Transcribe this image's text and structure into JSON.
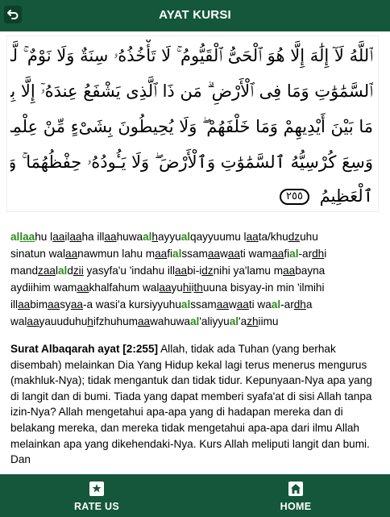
{
  "header": {
    "title": "AYAT KURSI",
    "back_icon": "back-arrow-icon"
  },
  "arabic": {
    "lines": [
      "ٱللَّهُ لَآ إِلَٰهَ إِلَّا هُوَ ٱلْحَىُّ ٱلْقَيُّومُ ۚ لَا تَأْخُذُهُۥ سِنَةٌ وَلَا نَوْمٌ ۚ لَّهُۥ مَا فِى",
      "ٱلسَّمَٰوَٰتِ وَمَا فِى ٱلْأَرْضِ ۗ مَن ذَا ٱلَّذِى يَشْفَعُ عِندَهُۥٓ إِلَّا بِإِذْنِهِۦ ۚ يَعْلَمُ",
      "مَا بَيْنَ أَيْدِيهِمْ وَمَا خَلْفَهُمْ ۖ وَلَا يُحِيطُونَ بِشَىْءٍ مِّنْ عِلْمِهِۦٓ إِلَّا بِمَا شَآءَ ۚ",
      "وَسِعَ كُرْسِيُّهُ ٱلسَّمَٰوَٰتِ وَٱلْأَرْضَ ۖ وَلَا يَـُٔودُهُۥ حِفْظُهُمَا ۚ وَهُوَ ٱلْعَلِىُّ",
      "ٱلْعَظِيمُ"
    ],
    "ayah_number": "٢٥٥"
  },
  "latin": {
    "l1": [
      {
        "t": "al",
        "s": "g"
      },
      {
        "t": "laa",
        "s": "gu"
      },
      {
        "t": "hu ",
        "s": ""
      },
      {
        "t": "l",
        "s": ""
      },
      {
        "t": "aa",
        "s": "u"
      },
      {
        "t": "il",
        "s": ""
      },
      {
        "t": "aa",
        "s": "u"
      },
      {
        "t": "ha ill",
        "s": ""
      },
      {
        "t": "aa",
        "s": "u"
      },
      {
        "t": "huwa",
        "s": ""
      },
      {
        "t": "al",
        "s": "g"
      },
      {
        "t": "h",
        "s": "u"
      },
      {
        "t": "ayyu",
        "s": ""
      },
      {
        "t": "al",
        "s": "g"
      },
      {
        "t": "qayyuumu l",
        "s": ""
      },
      {
        "t": "aa",
        "s": "u"
      },
      {
        "t": "ta/khu",
        "s": ""
      },
      {
        "t": "dz",
        "s": "u"
      },
      {
        "t": "uhu",
        "s": ""
      }
    ],
    "l2": [
      {
        "t": "sinatun wal",
        "s": ""
      },
      {
        "t": "aa",
        "s": "u"
      },
      {
        "t": "nawmun lahu m",
        "s": ""
      },
      {
        "t": "aa",
        "s": "u"
      },
      {
        "t": "fi",
        "s": ""
      },
      {
        "t": "al",
        "s": "g"
      },
      {
        "t": "ssam",
        "s": ""
      },
      {
        "t": "aa",
        "s": "u"
      },
      {
        "t": "w",
        "s": ""
      },
      {
        "t": "aa",
        "s": "u"
      },
      {
        "t": "ti wam",
        "s": ""
      },
      {
        "t": "aa",
        "s": "u"
      },
      {
        "t": "fi",
        "s": ""
      },
      {
        "t": "al",
        "s": "g"
      },
      {
        "t": "-ar",
        "s": ""
      },
      {
        "t": "dh",
        "s": "u"
      },
      {
        "t": "i",
        "s": ""
      }
    ],
    "l3": [
      {
        "t": "mand",
        "s": ""
      },
      {
        "t": "zaa",
        "s": "u"
      },
      {
        "t": "l",
        "s": ""
      },
      {
        "t": "al",
        "s": "g"
      },
      {
        "t": "d",
        "s": ""
      },
      {
        "t": "zii",
        "s": "u"
      },
      {
        "t": " yasyfa'u 'indahu ill",
        "s": ""
      },
      {
        "t": "aa",
        "s": "u"
      },
      {
        "t": "bi-i",
        "s": ""
      },
      {
        "t": "dz",
        "s": "u"
      },
      {
        "t": "nihi ya'lamu m",
        "s": ""
      },
      {
        "t": "aa",
        "s": "u"
      },
      {
        "t": "bayna",
        "s": ""
      }
    ],
    "l4": [
      {
        "t": "aydiihim wam",
        "s": ""
      },
      {
        "t": "aa",
        "s": "u"
      },
      {
        "t": "khalfahum wal",
        "s": ""
      },
      {
        "t": "aa",
        "s": "u"
      },
      {
        "t": "yu",
        "s": ""
      },
      {
        "t": "hi",
        "s": "u"
      },
      {
        "t": "i",
        "s": ""
      },
      {
        "t": "th",
        "s": "u"
      },
      {
        "t": "uuna bisyay-in min 'ilmihi",
        "s": ""
      }
    ],
    "l5": [
      {
        "t": "ill",
        "s": ""
      },
      {
        "t": "aa",
        "s": "u"
      },
      {
        "t": "bim",
        "s": ""
      },
      {
        "t": "aa",
        "s": "u"
      },
      {
        "t": "sy",
        "s": ""
      },
      {
        "t": "aa",
        "s": "u"
      },
      {
        "t": "-a wasi'a kursiyyuhu",
        "s": ""
      },
      {
        "t": "al",
        "s": "g"
      },
      {
        "t": "ssam",
        "s": ""
      },
      {
        "t": "aa",
        "s": "u"
      },
      {
        "t": "w",
        "s": ""
      },
      {
        "t": "aa",
        "s": "u"
      },
      {
        "t": "ti wa",
        "s": ""
      },
      {
        "t": "al",
        "s": "g"
      },
      {
        "t": "-ar",
        "s": ""
      },
      {
        "t": "dh",
        "s": "u"
      },
      {
        "t": "a",
        "s": ""
      }
    ],
    "l6": [
      {
        "t": "wal",
        "s": ""
      },
      {
        "t": "aa",
        "s": "u"
      },
      {
        "t": "yauuduhu",
        "s": ""
      },
      {
        "t": "h",
        "s": "u"
      },
      {
        "t": "ifzhuhum",
        "s": ""
      },
      {
        "t": "aa",
        "s": "u"
      },
      {
        "t": "wahuwa",
        "s": ""
      },
      {
        "t": "al",
        "s": "g"
      },
      {
        "t": "'aliyyu",
        "s": ""
      },
      {
        "t": "al",
        "s": "g"
      },
      {
        "t": "'a",
        "s": ""
      },
      {
        "t": "zh",
        "s": "u"
      },
      {
        "t": "iimu",
        "s": ""
      }
    ]
  },
  "translation": {
    "source": "Surat Albaqarah ayat [2:255]",
    "text": " Allah, tidak ada Tuhan (yang berhak disembah) melainkan Dia Yang Hidup kekal lagi terus menerus mengurus (makhluk-Nya); tidak mengantuk dan tidak tidur. Kepunyaan-Nya apa yang di langit dan di bumi. Tiada yang dapat memberi syafa'at di sisi Allah tanpa izin-Nya? Allah mengetahui apa-apa yang di hadapan mereka dan di belakang mereka, dan mereka tidak mengetahui apa-apa dari ilmu Allah melainkan apa yang dikehendaki-Nya. Kurs Allah meliputi langit dan bumi. Dan"
  },
  "bottom_nav": {
    "rate": {
      "label": "RATE US",
      "icon": "star-icon"
    },
    "home": {
      "label": "HOME",
      "icon": "home-icon"
    }
  },
  "colors": {
    "primary": "#14573a",
    "highlight": "#2f8a1e"
  }
}
